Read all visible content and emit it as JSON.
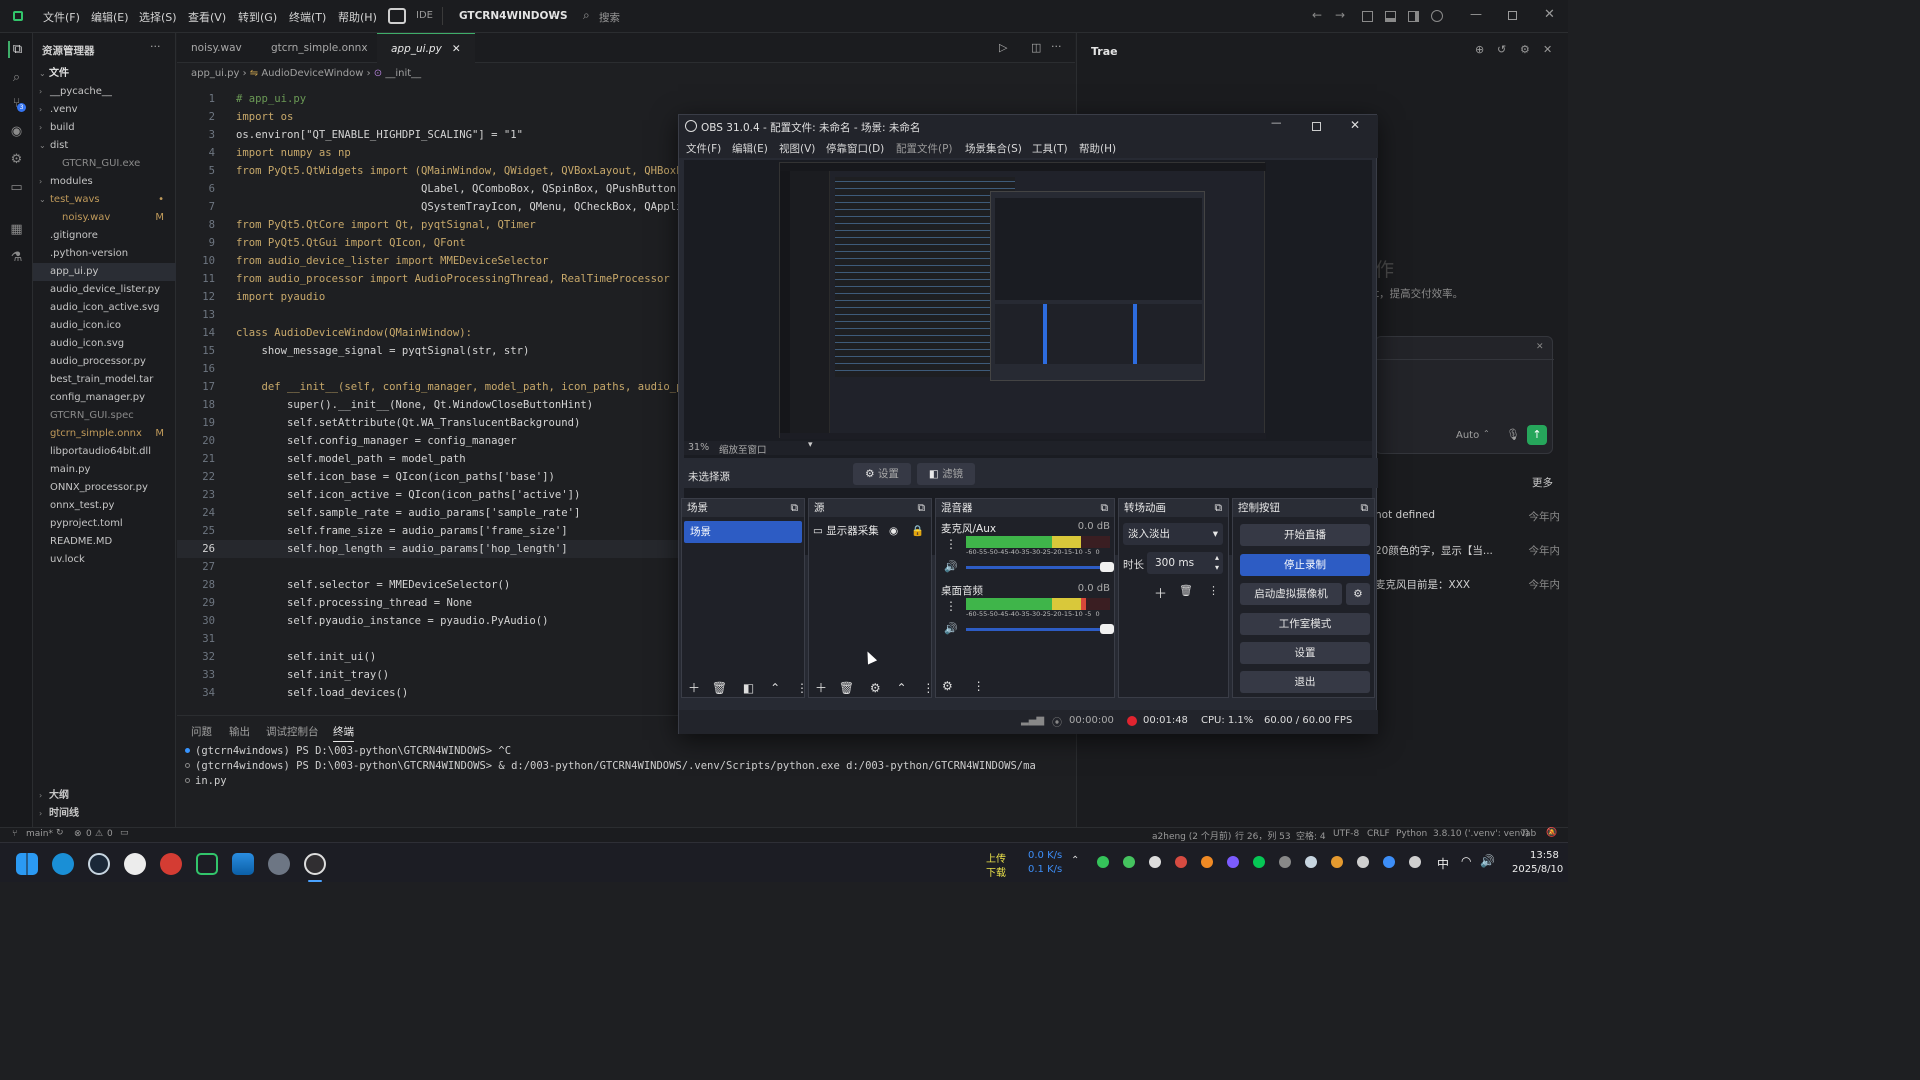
{
  "titlebar": {
    "menus": [
      "文件(F)",
      "编辑(E)",
      "选择(S)",
      "查看(V)",
      "转到(G)",
      "终端(T)",
      "帮助(H)"
    ],
    "ide_label": "IDE",
    "workspace": "GTCRN4WINDOWS",
    "search_placeholder": "搜索"
  },
  "explorer": {
    "title": "资源管理器",
    "section": "文件",
    "items": [
      {
        "label": "__pycache__",
        "indent": 1,
        "folder": true,
        "badge": ""
      },
      {
        "label": ".venv",
        "indent": 1,
        "folder": true,
        "badge": ""
      },
      {
        "label": "build",
        "indent": 1,
        "folder": true,
        "badge": ""
      },
      {
        "label": "dist",
        "indent": 1,
        "folder": true,
        "open": true,
        "badge": ""
      },
      {
        "label": "GTCRN_GUI.exe",
        "indent": 2,
        "folder": false,
        "badge": "",
        "dim": true
      },
      {
        "label": "modules",
        "indent": 1,
        "folder": true,
        "badge": ""
      },
      {
        "label": "test_wavs",
        "indent": 1,
        "folder": true,
        "open": true,
        "badge": "•",
        "color": "#c09a5a"
      },
      {
        "label": "noisy.wav",
        "indent": 2,
        "folder": false,
        "badge": "M",
        "color": "#c09a5a"
      },
      {
        "label": ".gitignore",
        "indent": 1,
        "folder": false,
        "badge": ""
      },
      {
        "label": ".python-version",
        "indent": 1,
        "folder": false,
        "badge": ""
      },
      {
        "label": "app_ui.py",
        "indent": 1,
        "folder": false,
        "badge": "",
        "selected": true
      },
      {
        "label": "audio_device_lister.py",
        "indent": 1,
        "folder": false,
        "badge": ""
      },
      {
        "label": "audio_icon_active.svg",
        "indent": 1,
        "folder": false,
        "badge": ""
      },
      {
        "label": "audio_icon.ico",
        "indent": 1,
        "folder": false,
        "badge": ""
      },
      {
        "label": "audio_icon.svg",
        "indent": 1,
        "folder": false,
        "badge": ""
      },
      {
        "label": "audio_processor.py",
        "indent": 1,
        "folder": false,
        "badge": ""
      },
      {
        "label": "best_train_model.tar",
        "indent": 1,
        "folder": false,
        "badge": ""
      },
      {
        "label": "config_manager.py",
        "indent": 1,
        "folder": false,
        "badge": ""
      },
      {
        "label": "GTCRN_GUI.spec",
        "indent": 1,
        "folder": false,
        "badge": "",
        "dim": true
      },
      {
        "label": "gtcrn_simple.onnx",
        "indent": 1,
        "folder": false,
        "badge": "M",
        "color": "#c09a5a"
      },
      {
        "label": "libportaudio64bit.dll",
        "indent": 1,
        "folder": false,
        "badge": ""
      },
      {
        "label": "main.py",
        "indent": 1,
        "folder": false,
        "badge": ""
      },
      {
        "label": "ONNX_processor.py",
        "indent": 1,
        "folder": false,
        "badge": ""
      },
      {
        "label": "onnx_test.py",
        "indent": 1,
        "folder": false,
        "badge": ""
      },
      {
        "label": "pyproject.toml",
        "indent": 1,
        "folder": false,
        "badge": ""
      },
      {
        "label": "README.MD",
        "indent": 1,
        "folder": false,
        "badge": ""
      },
      {
        "label": "uv.lock",
        "indent": 1,
        "folder": false,
        "badge": ""
      }
    ],
    "outline": "大纲",
    "timeline": "时间线"
  },
  "editor": {
    "tabs": [
      "noisy.wav",
      "gtcrn_simple.onnx",
      "app_ui.py"
    ],
    "active_tab": "app_ui.py",
    "breadcrumb": [
      "app_ui.py",
      "AudioDeviceWindow",
      "__init__"
    ],
    "lines": [
      "# app_ui.py",
      "import os",
      "os.environ[\"QT_ENABLE_HIGHDPI_SCALING\"] = \"1\"",
      "import numpy as np",
      "from PyQt5.QtWidgets import (QMainWindow, QWidget, QVBoxLayout, QHBoxL",
      "                             QLabel, QComboBox, QSpinBox, QPushButton,",
      "                             QSystemTrayIcon, QMenu, QCheckBox, QApplic",
      "from PyQt5.QtCore import Qt, pyqtSignal, QTimer",
      "from PyQt5.QtGui import QIcon, QFont",
      "from audio_device_lister import MMEDeviceSelector",
      "from audio_processor import AudioProcessingThread, RealTimeProcessor",
      "import pyaudio",
      "",
      "class AudioDeviceWindow(QMainWindow):",
      "    show_message_signal = pyqtSignal(str, str)",
      "",
      "    def __init__(self, config_manager, model_path, icon_paths, audio_p",
      "        super().__init__(None, Qt.WindowCloseButtonHint)",
      "        self.setAttribute(Qt.WA_TranslucentBackground)",
      "        self.config_manager = config_manager",
      "        self.model_path = model_path",
      "        self.icon_base = QIcon(icon_paths['base'])",
      "        self.icon_active = QIcon(icon_paths['active'])",
      "        self.sample_rate = audio_params['sample_rate']",
      "        self.frame_size = audio_params['frame_size']",
      "        self.hop_length = audio_params['hop_length']",
      "",
      "        self.selector = MMEDeviceSelector()",
      "        self.processing_thread = None",
      "        self.pyaudio_instance = pyaudio.PyAudio()",
      "",
      "        self.init_ui()",
      "        self.init_tray()",
      "        self.load_devices()"
    ],
    "current_line": 26
  },
  "panel": {
    "tabs": [
      "问题",
      "输出",
      "调试控制台",
      "终端"
    ],
    "active": "终端",
    "terminal": [
      "(gtcrn4windows) PS D:\\003-python\\GTCRN4WINDOWS> ^C",
      "(gtcrn4windows) PS D:\\003-python\\GTCRN4WINDOWS> & d:/003-python/GTCRN4WINDOWS/.venv/Scripts/python.exe d:/003-python/GTCRN4WINDOWS/ma",
      "in.py"
    ]
  },
  "rightpanel": {
    "title": "Trae",
    "hint_char": "作",
    "hint_text": "t，提高交付效率。",
    "more": "更多",
    "auto": "Auto",
    "history": [
      {
        "text": "not defined",
        "time": "今年内"
      },
      {
        "text": "20颜色的字，显示【当...",
        "time": "今年内"
      },
      {
        "text": "麦克风目前是：XXX",
        "time": "今年内"
      }
    ]
  },
  "obs": {
    "title": "OBS 31.0.4 - 配置文件: 未命名 - 场景: 未命名",
    "menus": [
      "文件(F)",
      "编辑(E)",
      "视图(V)",
      "停靠窗口(D)",
      "配置文件(P)",
      "场景集合(S)",
      "工具(T)",
      "帮助(H)"
    ],
    "zoom": "31%",
    "zoom_mode": "缩放至窗口",
    "no_source": "未选择源",
    "settings_btn": "设置",
    "filters_btn": "滤镜",
    "docks": {
      "scenes": {
        "title": "场景",
        "items": [
          "场景"
        ]
      },
      "sources": {
        "title": "源",
        "items": [
          "显示器采集"
        ]
      },
      "mixer": {
        "title": "混音器",
        "channels": [
          {
            "name": "麦克风/Aux",
            "db": "0.0 dB",
            "level": 0.8
          },
          {
            "name": "桌面音频",
            "db": "0.0 dB",
            "level": 0.83
          }
        ],
        "scale": "-60-55-50-45-40-35-30-25-20-15-10 -5  0"
      },
      "transitions": {
        "title": "转场动画",
        "type": "淡入淡出",
        "duration_label": "时长",
        "duration": "300 ms"
      },
      "controls": {
        "title": "控制按钮",
        "buttons": [
          "开始直播",
          "停止录制",
          "启动虚拟摄像机",
          "工作室模式",
          "设置",
          "退出"
        ]
      }
    },
    "status": {
      "stream_time": "00:00:00",
      "rec_time": "00:01:48",
      "cpu": "CPU: 1.1%",
      "fps": "60.00 / 60.00 FPS"
    }
  },
  "statusbar": {
    "branch": "main*",
    "errors": "0",
    "warnings": "0",
    "author": "a2heng (2 个月前)",
    "position": "行 26，列 53",
    "spaces": "空格: 4",
    "encoding": "UTF-8",
    "eol": "CRLF",
    "language": "Python",
    "interpreter": "3.8.10 ('.venv': venv)",
    "tab": "Tab"
  },
  "taskbar": {
    "up_label": "上传",
    "down_label": "下载",
    "up_speed": "0.0 K/s",
    "down_speed": "0.1 K/s",
    "ime": "中",
    "time": "13:58",
    "date": "2025/8/10"
  }
}
